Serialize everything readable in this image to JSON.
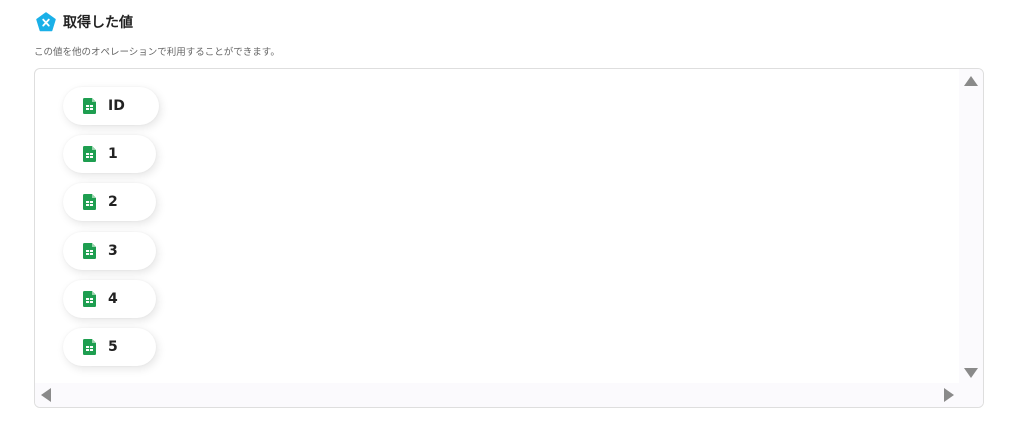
{
  "header": {
    "icon": "x-pentagon-icon",
    "title": "取得した値",
    "description": "この値を他のオペレーションで利用することができます。"
  },
  "values_panel": {
    "item_icon": "google-sheets-icon",
    "items": [
      {
        "label": "ID"
      },
      {
        "label": "1"
      },
      {
        "label": "2"
      },
      {
        "label": "3"
      },
      {
        "label": "4"
      },
      {
        "label": "5"
      }
    ]
  },
  "colors": {
    "accent": "#1ab0e8",
    "sheets_green": "#1e9e50",
    "scroll_arrow": "#8a8a8a"
  }
}
